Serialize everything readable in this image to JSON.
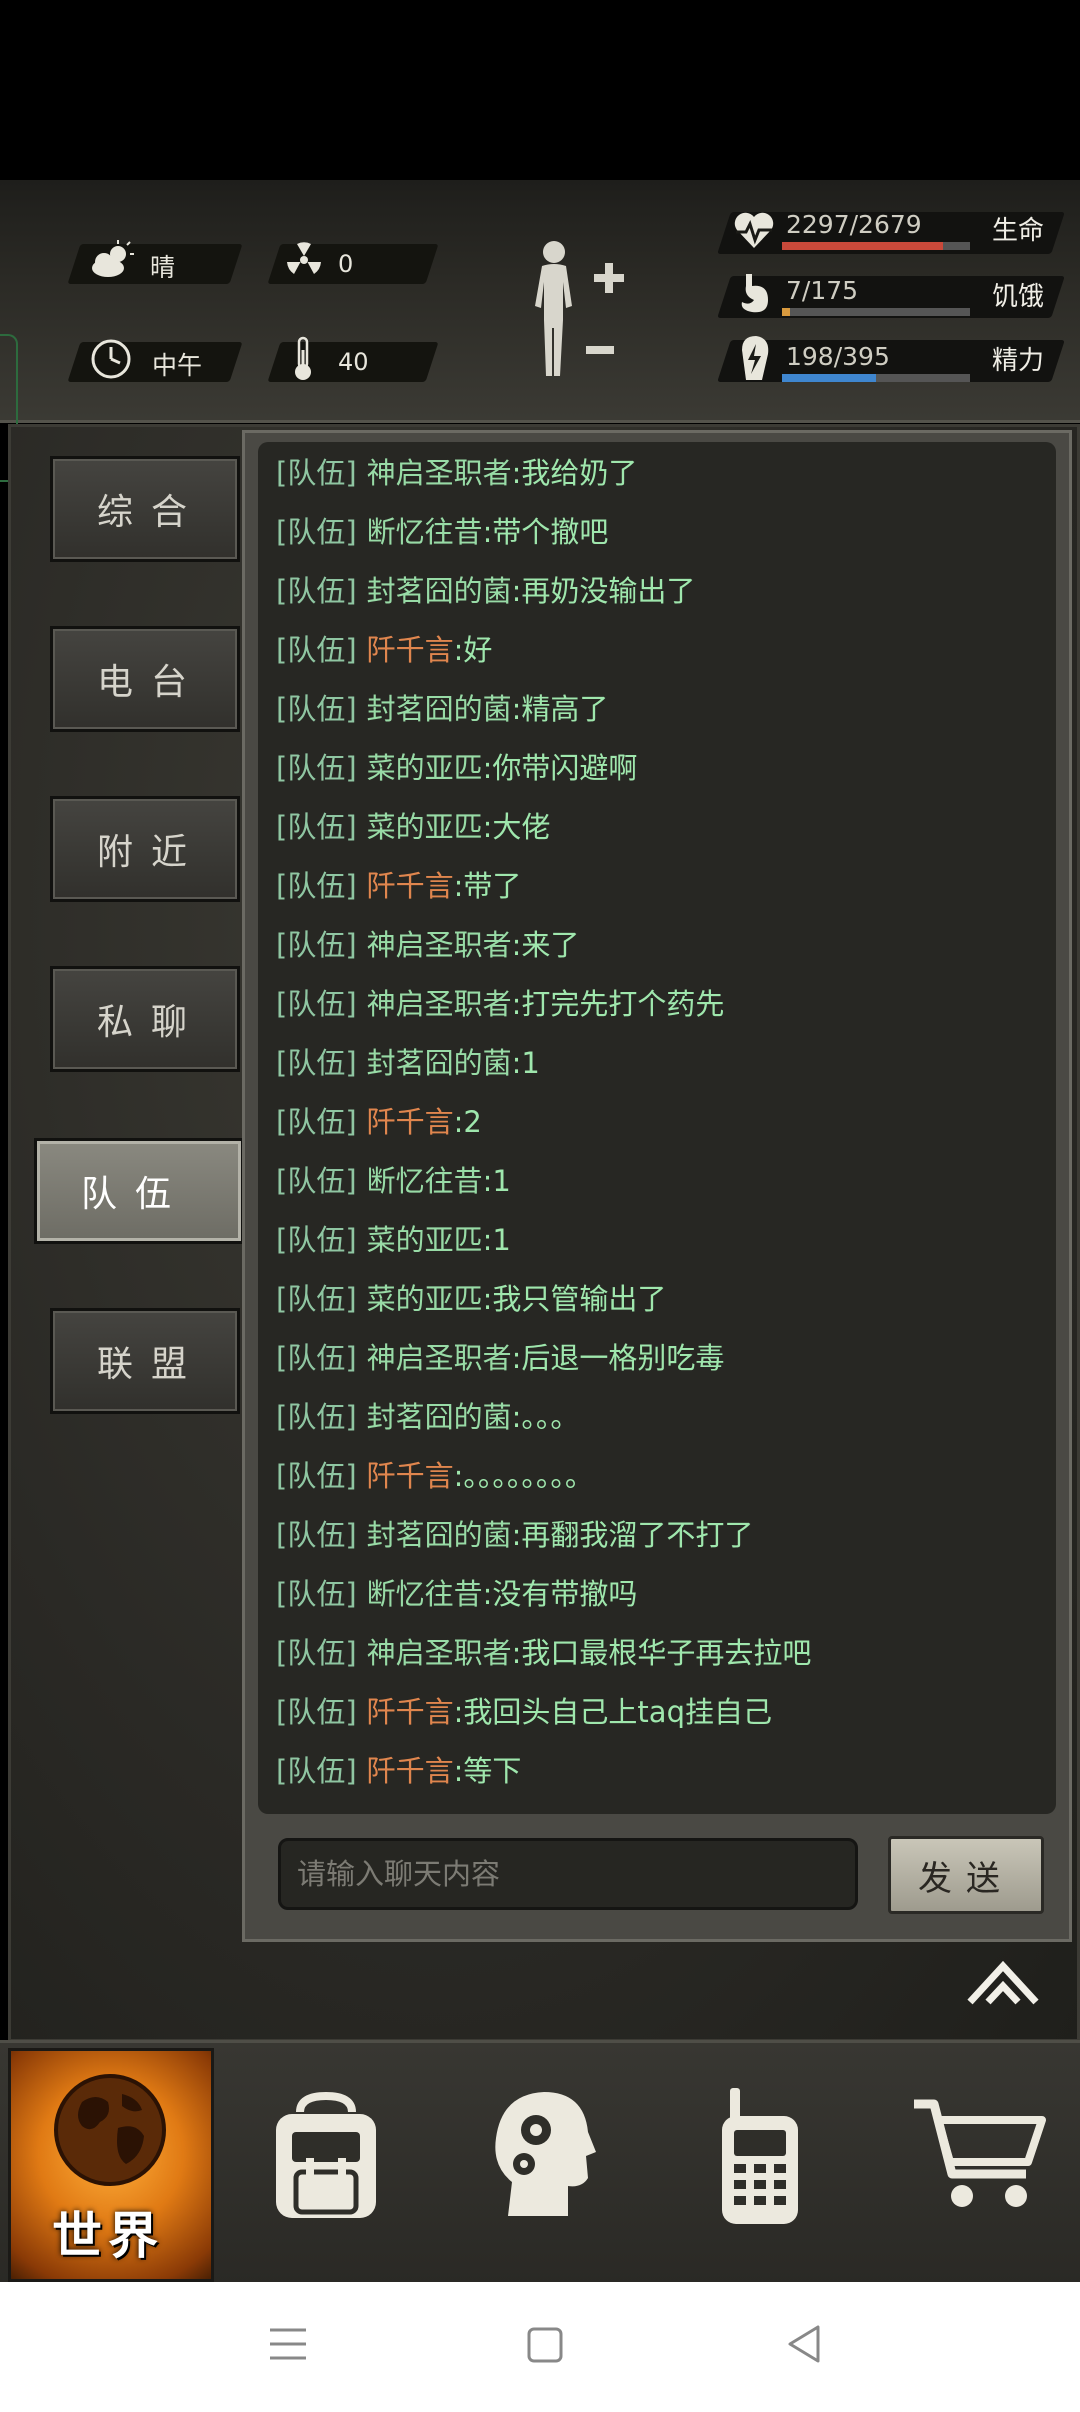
{
  "status": {
    "weather": {
      "icon": "cloud-sun-icon",
      "label": "晴"
    },
    "radiation": {
      "icon": "radiation-icon",
      "value": "0"
    },
    "time": {
      "icon": "clock-icon",
      "label": "中午"
    },
    "temperature": {
      "icon": "thermometer-icon",
      "value": "40"
    },
    "bars": [
      {
        "icon": "heart-rate-icon",
        "value": "2297/2679",
        "label": "生命",
        "fraction": 0.857,
        "color": "#c9493a"
      },
      {
        "icon": "stomach-icon",
        "value": "7/175",
        "label": "饥饿",
        "fraction": 0.04,
        "color": "#d99a3e"
      },
      {
        "icon": "energy-icon",
        "value": "198/395",
        "label": "精力",
        "fraction": 0.501,
        "color": "#3f86cf"
      }
    ]
  },
  "tabs": [
    {
      "label": "综合",
      "active": false
    },
    {
      "label": "电台",
      "active": false
    },
    {
      "label": "附近",
      "active": false
    },
    {
      "label": "私聊",
      "active": false
    },
    {
      "label": "队伍",
      "active": true
    },
    {
      "label": "联盟",
      "active": false
    }
  ],
  "chat": {
    "tag": "[队伍]",
    "messages": [
      {
        "name": "神启圣职者",
        "text": ":我给奶了",
        "highlight": false
      },
      {
        "name": "断忆往昔",
        "text": ":带个撤吧",
        "highlight": false
      },
      {
        "name": "封茗囧的菌",
        "text": ":再奶没输出了",
        "highlight": false
      },
      {
        "name": "阡千言",
        "text": ":好",
        "highlight": true
      },
      {
        "name": "封茗囧的菌",
        "text": ":精高了",
        "highlight": false
      },
      {
        "name": "菜的亚匹",
        "text": ":你带闪避啊",
        "highlight": false
      },
      {
        "name": "菜的亚匹",
        "text": ":大佬",
        "highlight": false
      },
      {
        "name": "阡千言",
        "text": ":带了",
        "highlight": true
      },
      {
        "name": "神启圣职者",
        "text": ":来了",
        "highlight": false
      },
      {
        "name": "神启圣职者",
        "text": ":打完先打个药先",
        "highlight": false
      },
      {
        "name": "封茗囧的菌",
        "text": ":1",
        "highlight": false
      },
      {
        "name": "阡千言",
        "text": ":2",
        "highlight": true
      },
      {
        "name": "断忆往昔",
        "text": ":1",
        "highlight": false
      },
      {
        "name": "菜的亚匹",
        "text": ":1",
        "highlight": false
      },
      {
        "name": "菜的亚匹",
        "text": ":我只管输出了",
        "highlight": false
      },
      {
        "name": "神启圣职者",
        "text": ":后退一格别吃毒",
        "highlight": false
      },
      {
        "name": "封茗囧的菌",
        "text": ":。。。",
        "highlight": false
      },
      {
        "name": "阡千言",
        "text": ":。。。。。。。。",
        "highlight": true
      },
      {
        "name": "封茗囧的菌",
        "text": ":再翻我溜了不打了",
        "highlight": false
      },
      {
        "name": "断忆往昔",
        "text": ":没有带撤吗",
        "highlight": false
      },
      {
        "name": "神启圣职者",
        "text": ":我口最根华子再去拉吧",
        "highlight": false
      },
      {
        "name": "阡千言",
        "text": ":我回头自己上taq挂自己",
        "highlight": true
      },
      {
        "name": "阡千言",
        "text": ":等下",
        "highlight": true
      }
    ],
    "input_placeholder": "请输入聊天内容",
    "send_label": "发送"
  },
  "dock": [
    {
      "label": "世界",
      "icon": "globe-icon",
      "active": true
    },
    {
      "label": "",
      "icon": "backpack-icon",
      "active": false
    },
    {
      "label": "",
      "icon": "head-gears-icon",
      "active": false
    },
    {
      "label": "",
      "icon": "walkie-talkie-icon",
      "active": false
    },
    {
      "label": "",
      "icon": "shopping-cart-icon",
      "active": false
    }
  ],
  "system_nav": [
    "menu-icon",
    "home-icon",
    "back-icon"
  ]
}
